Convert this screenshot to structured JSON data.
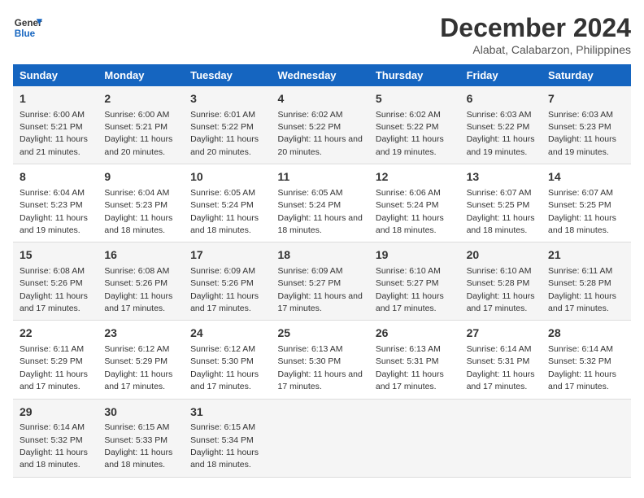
{
  "logo": {
    "line1": "General",
    "line2": "Blue"
  },
  "title": "December 2024",
  "subtitle": "Alabat, Calabarzon, Philippines",
  "days_of_week": [
    "Sunday",
    "Monday",
    "Tuesday",
    "Wednesday",
    "Thursday",
    "Friday",
    "Saturday"
  ],
  "weeks": [
    [
      {
        "day": "1",
        "sunrise": "Sunrise: 6:00 AM",
        "sunset": "Sunset: 5:21 PM",
        "daylight": "Daylight: 11 hours and 21 minutes."
      },
      {
        "day": "2",
        "sunrise": "Sunrise: 6:00 AM",
        "sunset": "Sunset: 5:21 PM",
        "daylight": "Daylight: 11 hours and 20 minutes."
      },
      {
        "day": "3",
        "sunrise": "Sunrise: 6:01 AM",
        "sunset": "Sunset: 5:22 PM",
        "daylight": "Daylight: 11 hours and 20 minutes."
      },
      {
        "day": "4",
        "sunrise": "Sunrise: 6:02 AM",
        "sunset": "Sunset: 5:22 PM",
        "daylight": "Daylight: 11 hours and 20 minutes."
      },
      {
        "day": "5",
        "sunrise": "Sunrise: 6:02 AM",
        "sunset": "Sunset: 5:22 PM",
        "daylight": "Daylight: 11 hours and 19 minutes."
      },
      {
        "day": "6",
        "sunrise": "Sunrise: 6:03 AM",
        "sunset": "Sunset: 5:22 PM",
        "daylight": "Daylight: 11 hours and 19 minutes."
      },
      {
        "day": "7",
        "sunrise": "Sunrise: 6:03 AM",
        "sunset": "Sunset: 5:23 PM",
        "daylight": "Daylight: 11 hours and 19 minutes."
      }
    ],
    [
      {
        "day": "8",
        "sunrise": "Sunrise: 6:04 AM",
        "sunset": "Sunset: 5:23 PM",
        "daylight": "Daylight: 11 hours and 19 minutes."
      },
      {
        "day": "9",
        "sunrise": "Sunrise: 6:04 AM",
        "sunset": "Sunset: 5:23 PM",
        "daylight": "Daylight: 11 hours and 18 minutes."
      },
      {
        "day": "10",
        "sunrise": "Sunrise: 6:05 AM",
        "sunset": "Sunset: 5:24 PM",
        "daylight": "Daylight: 11 hours and 18 minutes."
      },
      {
        "day": "11",
        "sunrise": "Sunrise: 6:05 AM",
        "sunset": "Sunset: 5:24 PM",
        "daylight": "Daylight: 11 hours and 18 minutes."
      },
      {
        "day": "12",
        "sunrise": "Sunrise: 6:06 AM",
        "sunset": "Sunset: 5:24 PM",
        "daylight": "Daylight: 11 hours and 18 minutes."
      },
      {
        "day": "13",
        "sunrise": "Sunrise: 6:07 AM",
        "sunset": "Sunset: 5:25 PM",
        "daylight": "Daylight: 11 hours and 18 minutes."
      },
      {
        "day": "14",
        "sunrise": "Sunrise: 6:07 AM",
        "sunset": "Sunset: 5:25 PM",
        "daylight": "Daylight: 11 hours and 18 minutes."
      }
    ],
    [
      {
        "day": "15",
        "sunrise": "Sunrise: 6:08 AM",
        "sunset": "Sunset: 5:26 PM",
        "daylight": "Daylight: 11 hours and 17 minutes."
      },
      {
        "day": "16",
        "sunrise": "Sunrise: 6:08 AM",
        "sunset": "Sunset: 5:26 PM",
        "daylight": "Daylight: 11 hours and 17 minutes."
      },
      {
        "day": "17",
        "sunrise": "Sunrise: 6:09 AM",
        "sunset": "Sunset: 5:26 PM",
        "daylight": "Daylight: 11 hours and 17 minutes."
      },
      {
        "day": "18",
        "sunrise": "Sunrise: 6:09 AM",
        "sunset": "Sunset: 5:27 PM",
        "daylight": "Daylight: 11 hours and 17 minutes."
      },
      {
        "day": "19",
        "sunrise": "Sunrise: 6:10 AM",
        "sunset": "Sunset: 5:27 PM",
        "daylight": "Daylight: 11 hours and 17 minutes."
      },
      {
        "day": "20",
        "sunrise": "Sunrise: 6:10 AM",
        "sunset": "Sunset: 5:28 PM",
        "daylight": "Daylight: 11 hours and 17 minutes."
      },
      {
        "day": "21",
        "sunrise": "Sunrise: 6:11 AM",
        "sunset": "Sunset: 5:28 PM",
        "daylight": "Daylight: 11 hours and 17 minutes."
      }
    ],
    [
      {
        "day": "22",
        "sunrise": "Sunrise: 6:11 AM",
        "sunset": "Sunset: 5:29 PM",
        "daylight": "Daylight: 11 hours and 17 minutes."
      },
      {
        "day": "23",
        "sunrise": "Sunrise: 6:12 AM",
        "sunset": "Sunset: 5:29 PM",
        "daylight": "Daylight: 11 hours and 17 minutes."
      },
      {
        "day": "24",
        "sunrise": "Sunrise: 6:12 AM",
        "sunset": "Sunset: 5:30 PM",
        "daylight": "Daylight: 11 hours and 17 minutes."
      },
      {
        "day": "25",
        "sunrise": "Sunrise: 6:13 AM",
        "sunset": "Sunset: 5:30 PM",
        "daylight": "Daylight: 11 hours and 17 minutes."
      },
      {
        "day": "26",
        "sunrise": "Sunrise: 6:13 AM",
        "sunset": "Sunset: 5:31 PM",
        "daylight": "Daylight: 11 hours and 17 minutes."
      },
      {
        "day": "27",
        "sunrise": "Sunrise: 6:14 AM",
        "sunset": "Sunset: 5:31 PM",
        "daylight": "Daylight: 11 hours and 17 minutes."
      },
      {
        "day": "28",
        "sunrise": "Sunrise: 6:14 AM",
        "sunset": "Sunset: 5:32 PM",
        "daylight": "Daylight: 11 hours and 17 minutes."
      }
    ],
    [
      {
        "day": "29",
        "sunrise": "Sunrise: 6:14 AM",
        "sunset": "Sunset: 5:32 PM",
        "daylight": "Daylight: 11 hours and 18 minutes."
      },
      {
        "day": "30",
        "sunrise": "Sunrise: 6:15 AM",
        "sunset": "Sunset: 5:33 PM",
        "daylight": "Daylight: 11 hours and 18 minutes."
      },
      {
        "day": "31",
        "sunrise": "Sunrise: 6:15 AM",
        "sunset": "Sunset: 5:34 PM",
        "daylight": "Daylight: 11 hours and 18 minutes."
      },
      null,
      null,
      null,
      null
    ]
  ]
}
